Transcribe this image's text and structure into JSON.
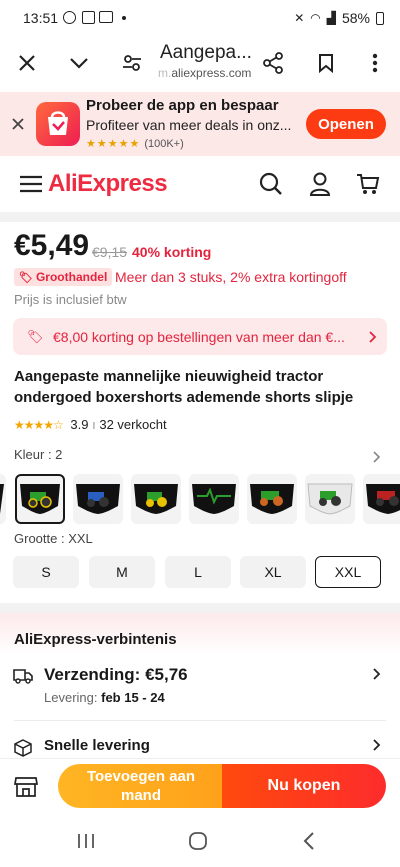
{
  "status": {
    "time": "13:51",
    "battery": "58%"
  },
  "browser": {
    "title": "Aangepa...",
    "url": "aliexpress.com",
    "url_prefix": "m."
  },
  "banner": {
    "title": "Probeer de app en bespaar",
    "subtitle": "Profiteer van meer deals in onz...",
    "stars": "★★★★★",
    "reviews": "(100K+)",
    "open_label": "Openen"
  },
  "header": {
    "brand": "AliExpress",
    "brand_color": "#ee2b40"
  },
  "product": {
    "price": "€5,49",
    "old_price": "€9,15",
    "discount": "40% korting",
    "wholesale_badge": "Groothandel",
    "wholesale_text": "Meer dan 3 stuks, 2% extra kortingoff",
    "vat_note": "Prijs is inclusief btw",
    "coupon_text": "€8,00 korting op bestellingen van meer dan €...",
    "title": "Aangepaste mannelijke nieuwigheid tractor ondergoed boxershorts ademende shorts slipje",
    "rating_stars": "★★★★☆",
    "rating": "3.9",
    "sold": "32 verkocht",
    "color_label": "Kleur : 2",
    "size_label": "Grootte : XXL",
    "sizes": [
      "S",
      "M",
      "L",
      "XL",
      "XXL"
    ],
    "selected_size": "XXL"
  },
  "commitment": {
    "title": "AliExpress-verbintenis",
    "shipping": "Verzending: €5,76",
    "delivery_label": "Levering:",
    "delivery_dates": "feb 15 - 24",
    "fast_delivery": "Snelle levering"
  },
  "actions": {
    "add_to_cart": "Toevoegen aan mand",
    "buy_now": "Nu kopen"
  },
  "colors": {
    "accent": "#e4243d",
    "orange": "#ffa11a",
    "red": "#fd3b12"
  }
}
